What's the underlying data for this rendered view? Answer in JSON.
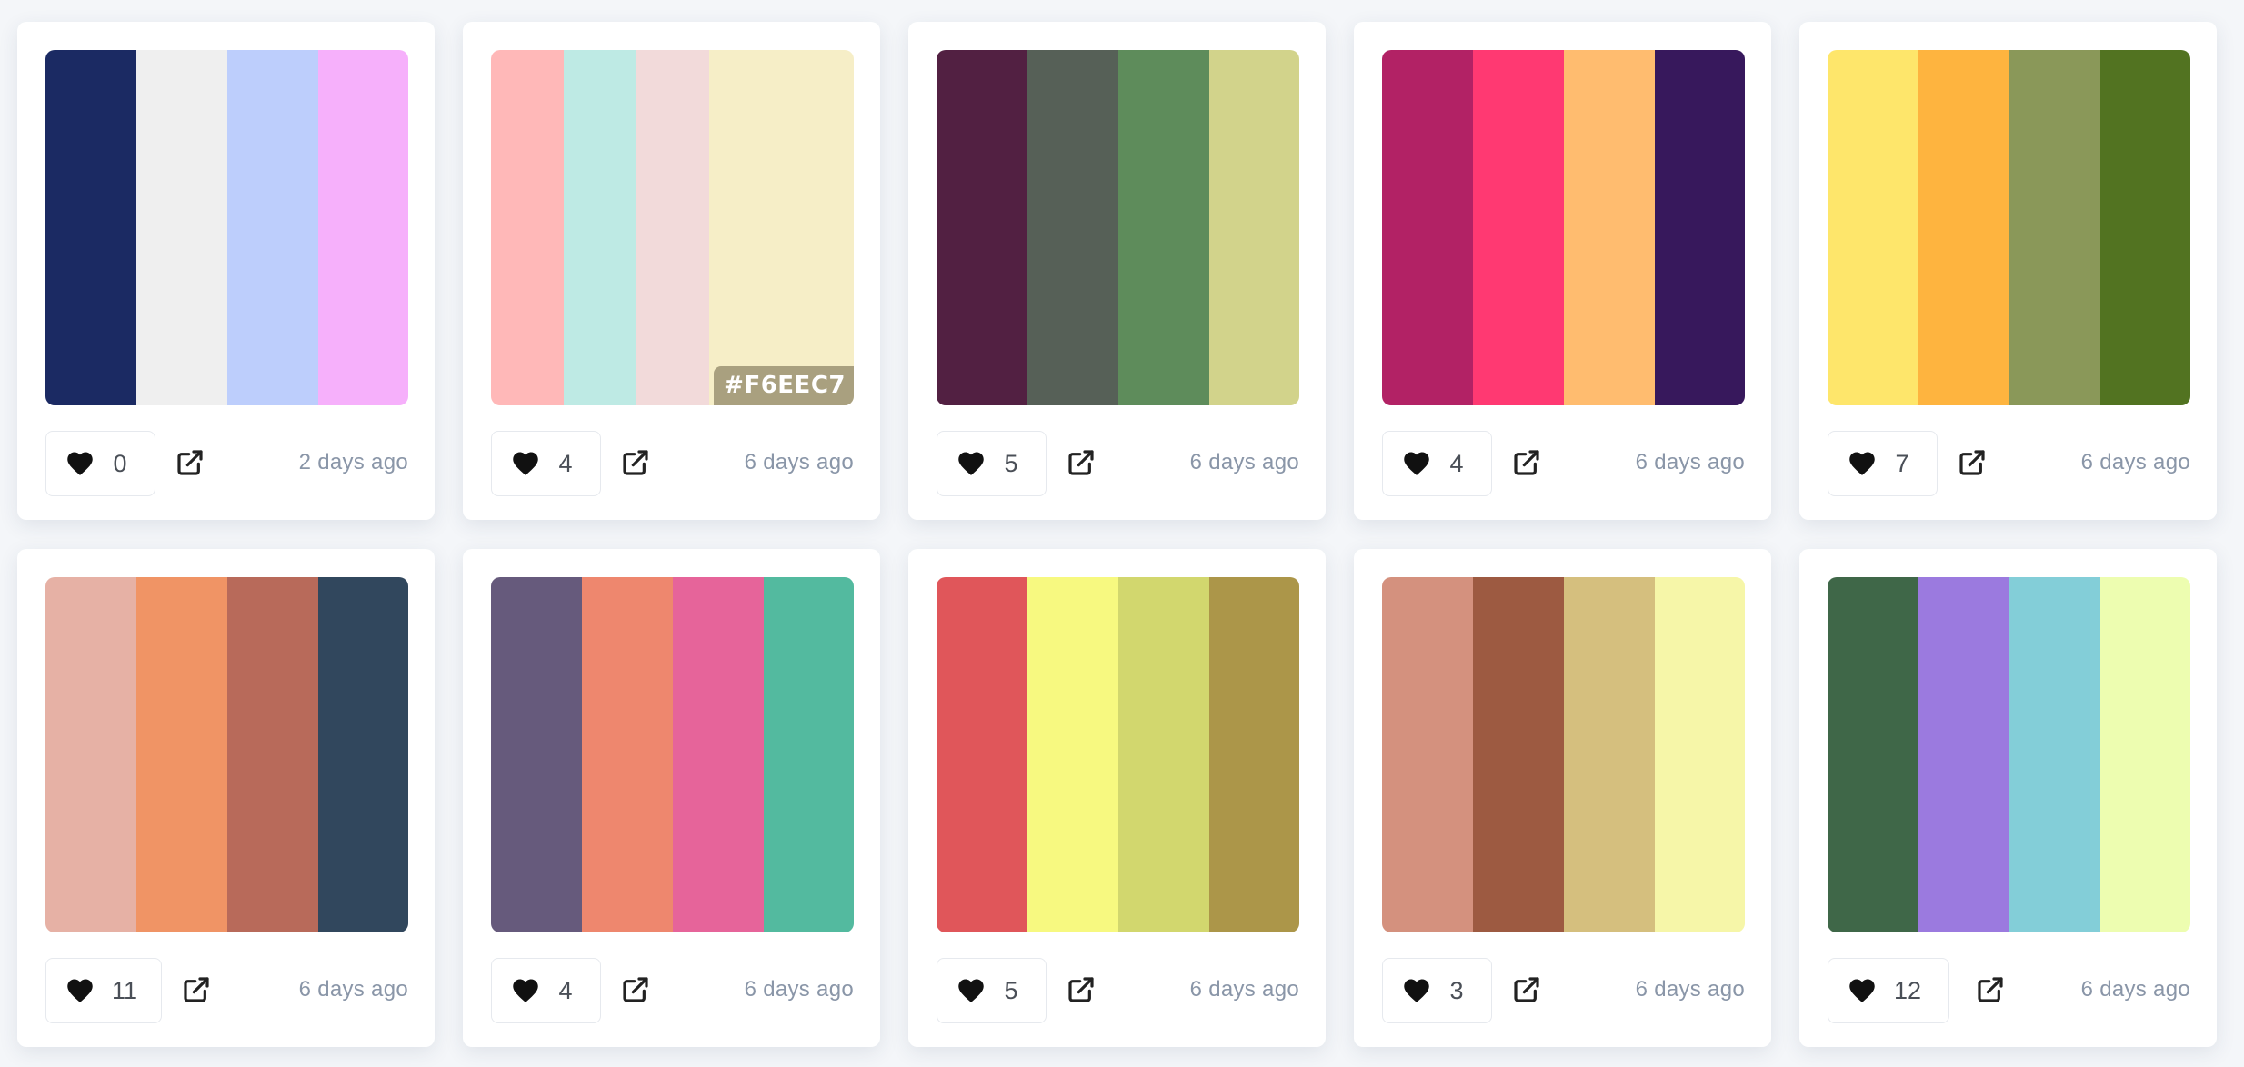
{
  "cards": [
    {
      "colors": [
        "#1B2A63",
        "#EFEFEF",
        "#BDCEFC",
        "#F6B0FB"
      ],
      "likes": "0",
      "time": "2 days ago"
    },
    {
      "colors": [
        "#FFB8B8",
        "#BEEAE4",
        "#F2DADA",
        "#F6EEC7"
      ],
      "likes": "4",
      "time": "6 days ago",
      "hover_label": "#F6EEC7"
    },
    {
      "colors": [
        "#522042",
        "#566057",
        "#5E8C5B",
        "#D2D38B"
      ],
      "likes": "5",
      "time": "6 days ago"
    },
    {
      "colors": [
        "#B22265",
        "#FF3972",
        "#FFBC6F",
        "#37185C"
      ],
      "likes": "4",
      "time": "6 days ago"
    },
    {
      "colors": [
        "#FEE66B",
        "#FEB43F",
        "#8A9859",
        "#527321"
      ],
      "likes": "7",
      "time": "6 days ago"
    },
    {
      "colors": [
        "#E6B1A5",
        "#F09465",
        "#B86A5A",
        "#31475D"
      ],
      "likes": "11",
      "time": "6 days ago"
    },
    {
      "colors": [
        "#665A7C",
        "#EE876E",
        "#E6649A",
        "#53BA9F"
      ],
      "likes": "4",
      "time": "6 days ago"
    },
    {
      "colors": [
        "#E0565A",
        "#F7F980",
        "#D2D76E",
        "#AC9649"
      ],
      "likes": "5",
      "time": "6 days ago"
    },
    {
      "colors": [
        "#D4917E",
        "#9D5A41",
        "#D5BF7E",
        "#F6F6A8"
      ],
      "likes": "3",
      "time": "6 days ago"
    },
    {
      "colors": [
        "#3F6748",
        "#9B7ADF",
        "#83CED8",
        "#EDFDB0"
      ],
      "likes": "12",
      "time": "6 days ago"
    }
  ]
}
